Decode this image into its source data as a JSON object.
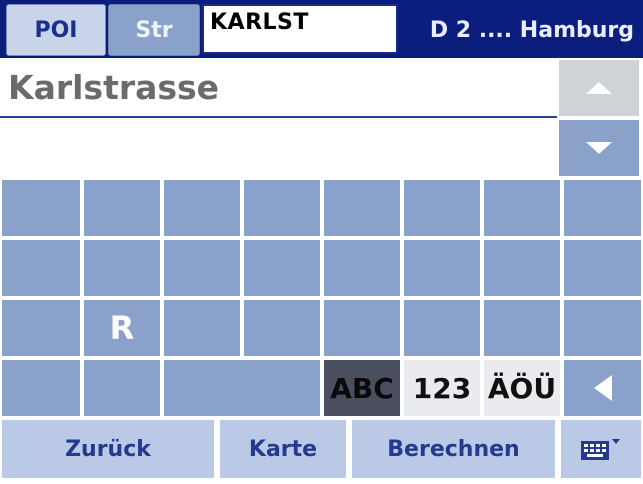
{
  "header": {
    "tabs": [
      {
        "label": "POI",
        "active": false
      },
      {
        "label": "Str",
        "active": true
      }
    ],
    "search_value": "KARLST",
    "region": "D 2 .... Hamburg"
  },
  "results": [
    {
      "label": "Karlstrasse"
    },
    {
      "label": ""
    }
  ],
  "keypad": {
    "rows": [
      [
        "",
        "",
        "",
        "",
        "",
        "",
        "",
        ""
      ],
      [
        "",
        "",
        "",
        "",
        "",
        "",
        "",
        ""
      ],
      [
        "",
        "R",
        "",
        "",
        "",
        "",
        "",
        ""
      ]
    ],
    "modes": [
      {
        "label": "ABC",
        "active": true
      },
      {
        "label": "123",
        "active": false
      },
      {
        "label": "ÄÖÜ",
        "active": false
      }
    ]
  },
  "buttons": {
    "back": "Zurück",
    "map": "Karte",
    "calculate": "Berechnen"
  },
  "colors": {
    "header_bg": "#0b1e7e",
    "key_bg": "#8aa2c9",
    "button_bg": "#b9c9e6",
    "button_text": "#243a8f"
  },
  "icons": {
    "scroll_up": "triangle-up-icon",
    "scroll_down": "triangle-down-icon",
    "backspace": "triangle-left-icon",
    "keyboard": "keyboard-icon"
  }
}
